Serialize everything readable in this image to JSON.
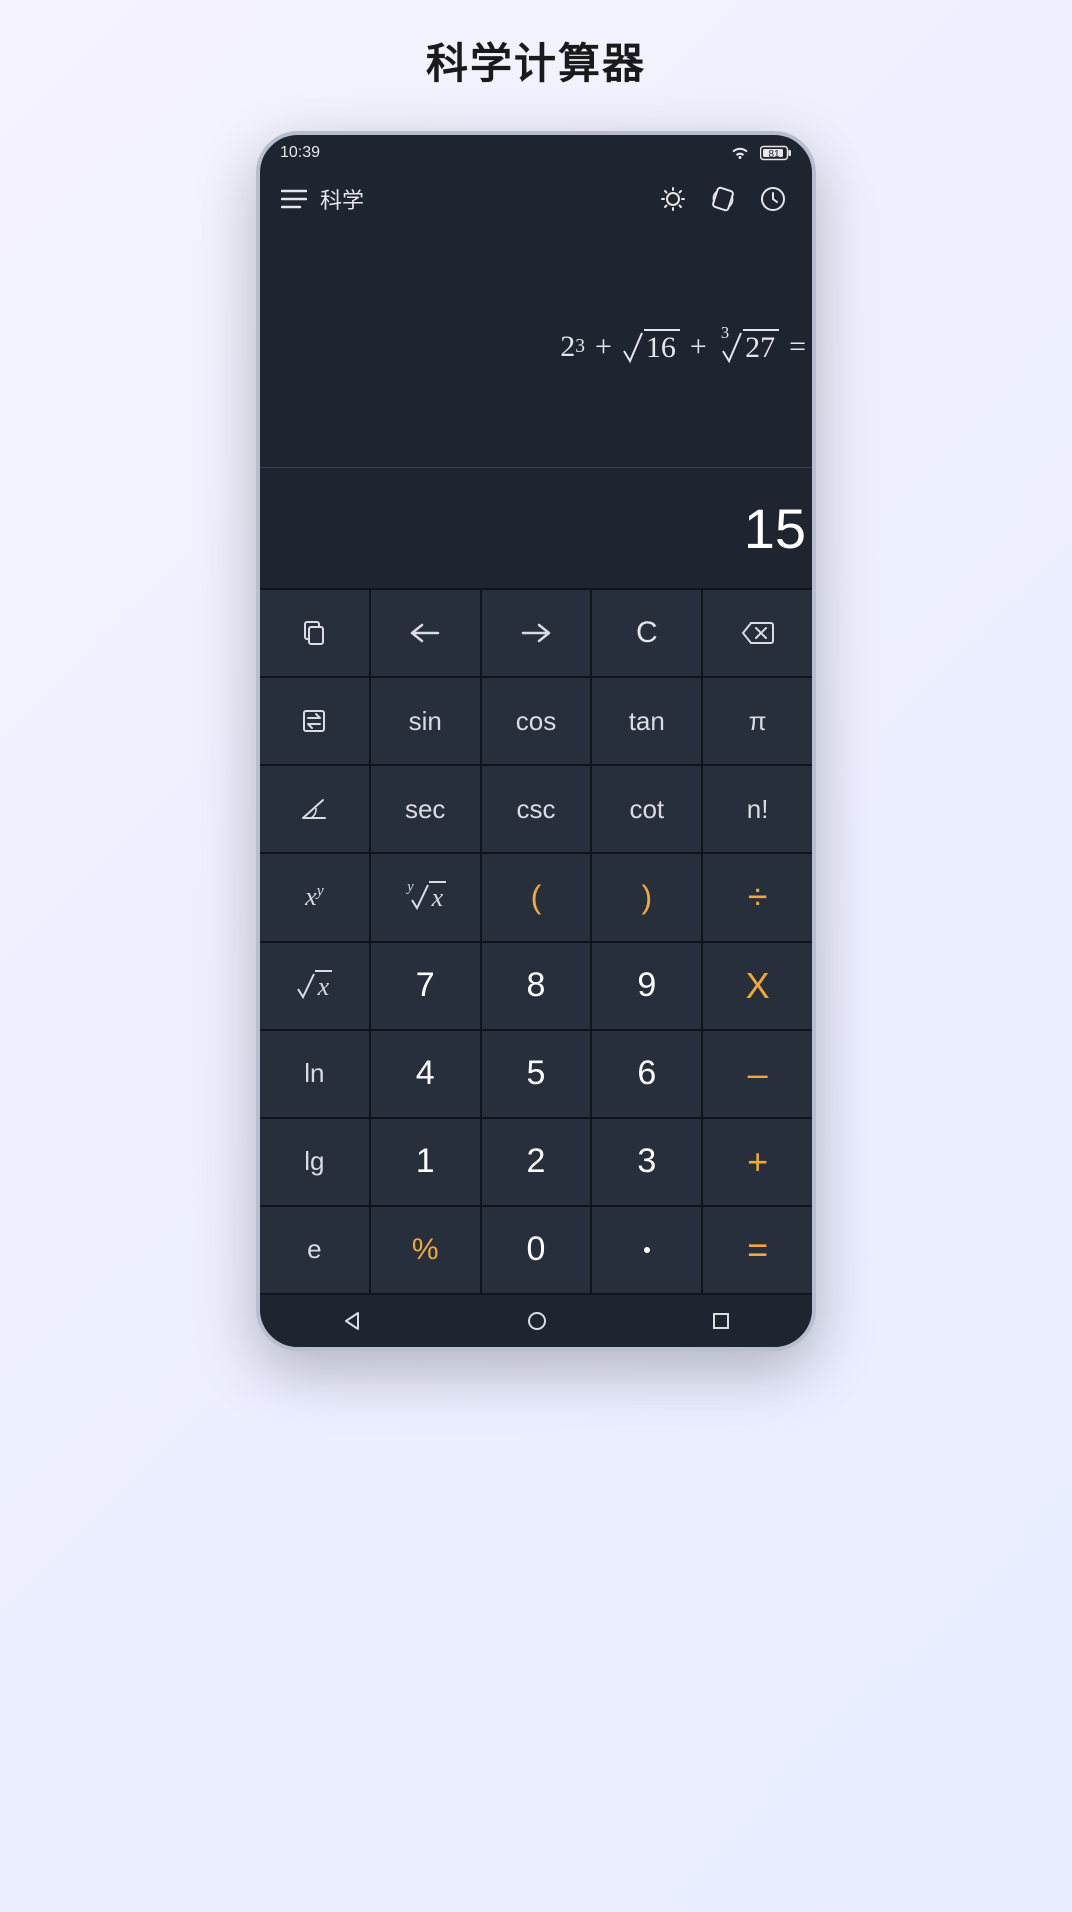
{
  "page": {
    "title": "科学计算器"
  },
  "status": {
    "time": "10:39",
    "battery": "81"
  },
  "header": {
    "title": "科学"
  },
  "display": {
    "expr": {
      "pow_base": "2",
      "pow_exp": "3",
      "sqrt_radicand": "16",
      "cbrt_index": "3",
      "cbrt_radicand": "27",
      "equals": "="
    },
    "result": "15"
  },
  "keys": {
    "sin": "sin",
    "cos": "cos",
    "tan": "tan",
    "pi": "π",
    "sec": "sec",
    "csc": "csc",
    "cot": "cot",
    "fact": "n!",
    "lparen": "(",
    "rparen": ")",
    "divide": "÷",
    "multiply": "X",
    "minus": "–",
    "plus": "+",
    "equals": "=",
    "percent": "%",
    "ln": "ln",
    "lg": "lg",
    "e": "e",
    "C": "C",
    "n7": "7",
    "n8": "8",
    "n9": "9",
    "n4": "4",
    "n5": "5",
    "n6": "6",
    "n1": "1",
    "n2": "2",
    "n3": "3",
    "n0": "0",
    "xy_base": "x",
    "xy_exp": "y",
    "yroot_index": "y",
    "yroot_x": "x",
    "sqrt_x": "x"
  }
}
